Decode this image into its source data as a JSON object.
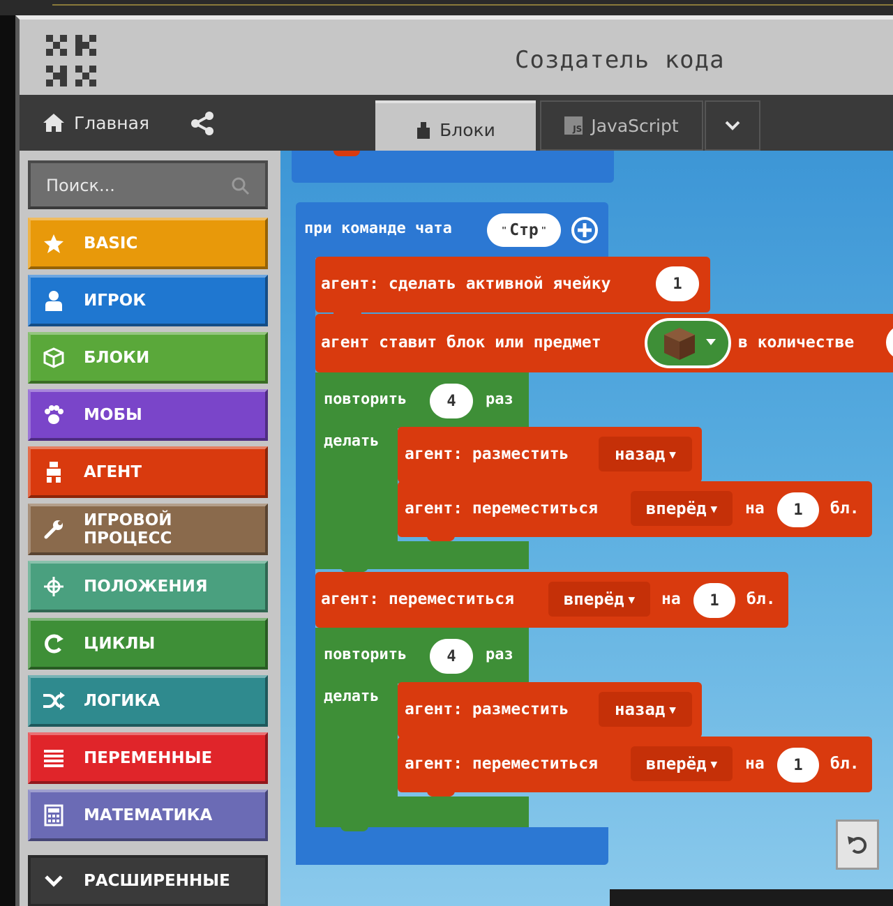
{
  "app": {
    "title": "Создатель кода"
  },
  "nav": {
    "home_label": "Главная",
    "blocks_tab": "Блоки",
    "js_tab": "JavaScript",
    "js_icon_text": "JS"
  },
  "search": {
    "placeholder": "Поиск..."
  },
  "categories": [
    {
      "label": "BASIC",
      "color": "#e8990a",
      "icon": "star-icon"
    },
    {
      "label": "ИГРОК",
      "color": "#1f77d0",
      "icon": "person-icon"
    },
    {
      "label": "БЛОКИ",
      "color": "#5aa83a",
      "icon": "cube-icon"
    },
    {
      "label": "МОБЫ",
      "color": "#7a45c9",
      "icon": "paw-icon"
    },
    {
      "label": "АГЕНТ",
      "color": "#d93a0e",
      "icon": "agent-icon"
    },
    {
      "label": "ИГРОВОЙ ПРОЦЕСС",
      "color": "#8a6a4c",
      "icon": "wrench-icon"
    },
    {
      "label": "ПОЛОЖЕНИЯ",
      "color": "#4aa07f",
      "icon": "crosshair-icon"
    },
    {
      "label": "ЦИКЛЫ",
      "color": "#3e8f37",
      "icon": "loop-icon"
    },
    {
      "label": "ЛОГИКА",
      "color": "#2f8a8e",
      "icon": "shuffle-icon"
    },
    {
      "label": "ПЕРЕМЕННЫЕ",
      "color": "#e0252a",
      "icon": "list-icon"
    },
    {
      "label": "МАТЕМАТИКА",
      "color": "#6b6bb5",
      "icon": "calculator-icon"
    },
    {
      "label": "РАСШИРЕННЫЕ",
      "color": "#3a3a3a",
      "icon": "chevron-down-icon"
    }
  ],
  "code": {
    "event": {
      "label": "при команде чата",
      "arg": "Стр"
    },
    "set_slot": {
      "label": "агент: сделать активной ячейку",
      "value": "1"
    },
    "give": {
      "label": "агент ставит блок или предмет",
      "suffix": "в количестве"
    },
    "loop1": {
      "repeat": "повторить",
      "count": "4",
      "times": "раз",
      "do": "делать"
    },
    "loop1_place": {
      "label": "агент: разместить",
      "dir": "назад"
    },
    "loop1_move": {
      "label": "агент: переместиться",
      "dir": "вперёд",
      "on": "на",
      "value": "1",
      "unit": "бл."
    },
    "mid_move": {
      "label": "агент: переместиться",
      "dir": "вперёд",
      "on": "на",
      "value": "1",
      "unit": "бл."
    },
    "loop2": {
      "repeat": "повторить",
      "count": "4",
      "times": "раз",
      "do": "делать"
    },
    "loop2_place": {
      "label": "агент: разместить",
      "dir": "назад"
    },
    "loop2_move": {
      "label": "агент: переместиться",
      "dir": "вперёд",
      "on": "на",
      "value": "1",
      "unit": "бл."
    }
  }
}
